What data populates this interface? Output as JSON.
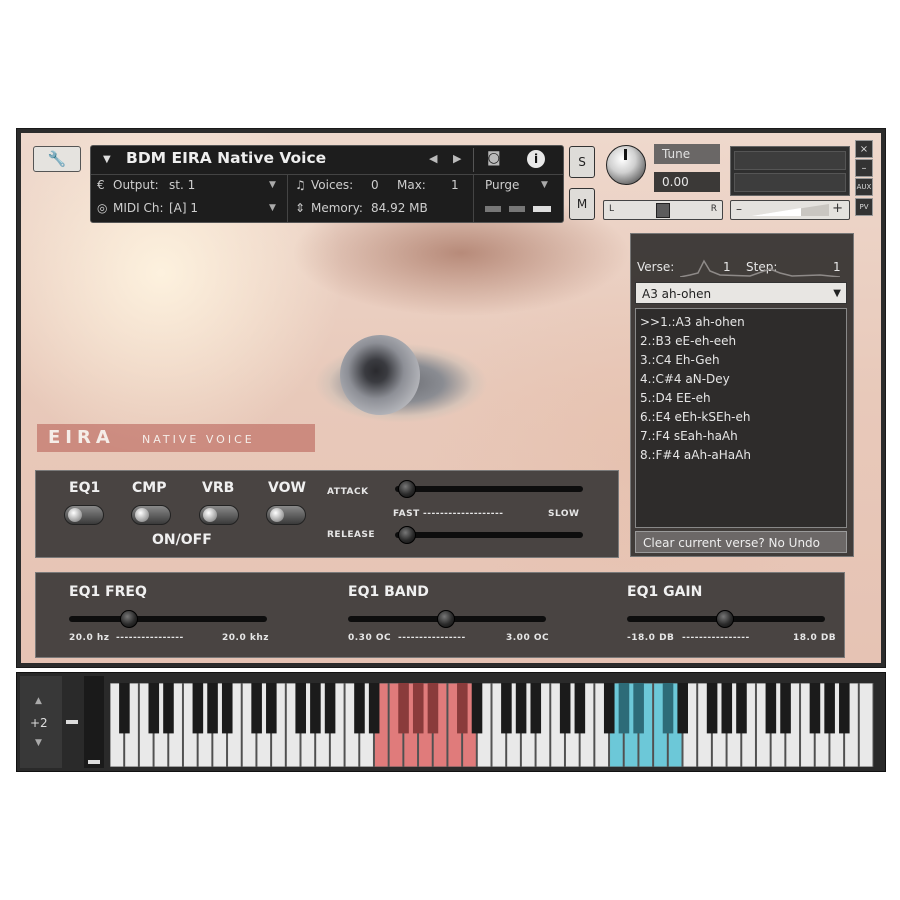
{
  "header": {
    "instrument_name": "BDM EIRA Native Voice",
    "output_label": "Output:",
    "output_value": "st. 1",
    "midi_label": "MIDI Ch:",
    "midi_value": "[A] 1",
    "voices_label": "Voices:",
    "voices_value": "0",
    "max_label": "Max:",
    "max_value": "1",
    "memory_label": "Memory:",
    "memory_value": "84.92 MB",
    "purge_label": "Purge",
    "solo_label": "S",
    "mute_label": "M"
  },
  "tune": {
    "label": "Tune",
    "value": "0.00",
    "pan_left": "L",
    "pan_right": "R"
  },
  "window_buttons": {
    "close": "×",
    "minimize": "–",
    "aux": "AUX",
    "pv": "PV"
  },
  "logo": {
    "big": "EIRA",
    "small": "NATIVE VOICE"
  },
  "verse_panel": {
    "verse_label": "Verse:",
    "verse_value": "1",
    "step_label": "Step:",
    "step_value": "1",
    "selected": "A3 ah-ohen",
    "items": [
      ">>1.:A3 ah-ohen",
      "2.:B3 eE-eh-eeh",
      "3.:C4 Eh-Geh",
      "4.:C#4 aN-Dey",
      "5.:D4 EE-eh",
      "6.:E4 eEh-kSEh-eh",
      "7.:F4 sEah-haAh",
      "8.:F#4 aAh-aHaAh"
    ],
    "clear_label": "Clear current verse? No Undo"
  },
  "effects": {
    "toggles": [
      {
        "label": "EQ1",
        "on": false
      },
      {
        "label": "CMP",
        "on": false
      },
      {
        "label": "VRB",
        "on": false
      },
      {
        "label": "VOW",
        "on": false
      }
    ],
    "onoff_label": "ON/OFF",
    "attack_label": "ATTACK",
    "release_label": "RELEASE",
    "range_fast": "FAST",
    "range_slow": "SLOW",
    "range_dashes": "-------------------",
    "attack_level": 0.02,
    "release_level": 0.02
  },
  "eq": {
    "freq": {
      "label": "EQ1 FREQ",
      "min": "20.0 hz",
      "max": "20.0 khz",
      "dashes": "----------------",
      "level": 0.28
    },
    "band": {
      "label": "EQ1 BAND",
      "min": "0.30 OC",
      "max": "3.00 OC",
      "dashes": "----------------",
      "level": 0.49
    },
    "gain": {
      "label": "EQ1 GAIN",
      "min": "-18.0 DB",
      "max": "18.0 DB",
      "dashes": "----------------",
      "level": 0.49
    }
  },
  "keyboard": {
    "octave_label": "+2",
    "up_arrow": "▲",
    "down_arrow": "▼",
    "red_range_white_keys": [
      18,
      24
    ],
    "blue_range_white_keys": [
      34,
      38
    ],
    "white_key_count": 52,
    "colors": {
      "red": "#e07b7b",
      "blue": "#6cc8d8"
    }
  },
  "icons": {
    "wrench": "wrench-icon",
    "camera": "camera-icon",
    "info": "info-icon",
    "output": "output-icon",
    "midi": "midi-icon",
    "voices": "voices-icon",
    "memory": "memory-icon"
  }
}
